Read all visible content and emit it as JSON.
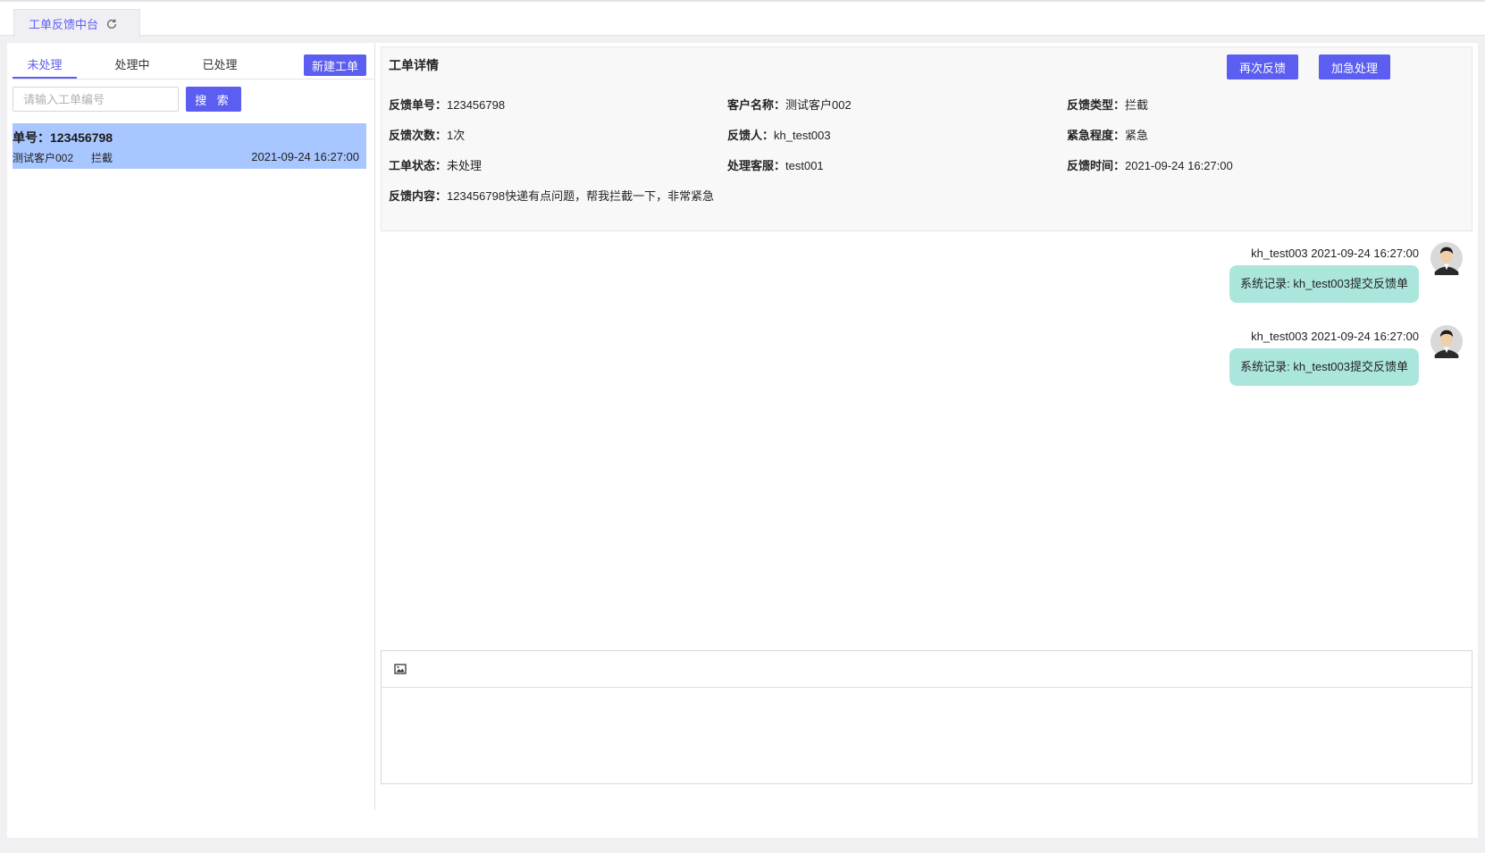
{
  "page_tab": {
    "label": "工单反馈中台",
    "refresh_icon": "refresh-icon"
  },
  "left": {
    "tabs": [
      {
        "label": "未处理",
        "active": true
      },
      {
        "label": "处理中",
        "active": false
      },
      {
        "label": "已处理",
        "active": false
      }
    ],
    "new_button": "新建工单",
    "search": {
      "placeholder": "请输入工单编号",
      "value": "",
      "button": "搜 索"
    },
    "tickets": [
      {
        "number": "单号：123456798",
        "customer": "测试客户002",
        "type": "拦截",
        "time": "2021-09-24 16:27:00"
      }
    ]
  },
  "details": {
    "title": "工单详情",
    "buttons": {
      "refeedback": "再次反馈",
      "urgent": "加急处理"
    },
    "fields": {
      "feedback_no": {
        "label": "反馈单号：",
        "value": "123456798"
      },
      "customer_name": {
        "label": "客户名称：",
        "value": "测试客户002"
      },
      "feedback_type": {
        "label": "反馈类型：",
        "value": "拦截"
      },
      "feedback_count": {
        "label": "反馈次数：",
        "value": "1次"
      },
      "feedback_person": {
        "label": "反馈人：",
        "value": "kh_test003"
      },
      "urgency": {
        "label": "紧急程度：",
        "value": "紧急"
      },
      "status": {
        "label": "工单状态：",
        "value": "未处理"
      },
      "handler": {
        "label": "处理客服：",
        "value": "test001"
      },
      "feedback_time": {
        "label": "反馈时间：",
        "value": "2021-09-24 16:27:00"
      },
      "content": {
        "label": "反馈内容：",
        "value": "123456798快递有点问题，帮我拦截一下，非常紧急"
      }
    }
  },
  "messages": [
    {
      "meta": "kh_test003 2021-09-24 16:27:00",
      "text": "系统记录: kh_test003提交反馈单"
    },
    {
      "meta": "kh_test003 2021-09-24 16:27:00",
      "text": "系统记录: kh_test003提交反馈单"
    }
  ],
  "editor": {
    "toolbar_icon": "image-icon",
    "content": ""
  },
  "colors": {
    "accent": "#5b5ef0",
    "selected_row": "#a8c6ff",
    "bubble": "#abe6dd"
  }
}
